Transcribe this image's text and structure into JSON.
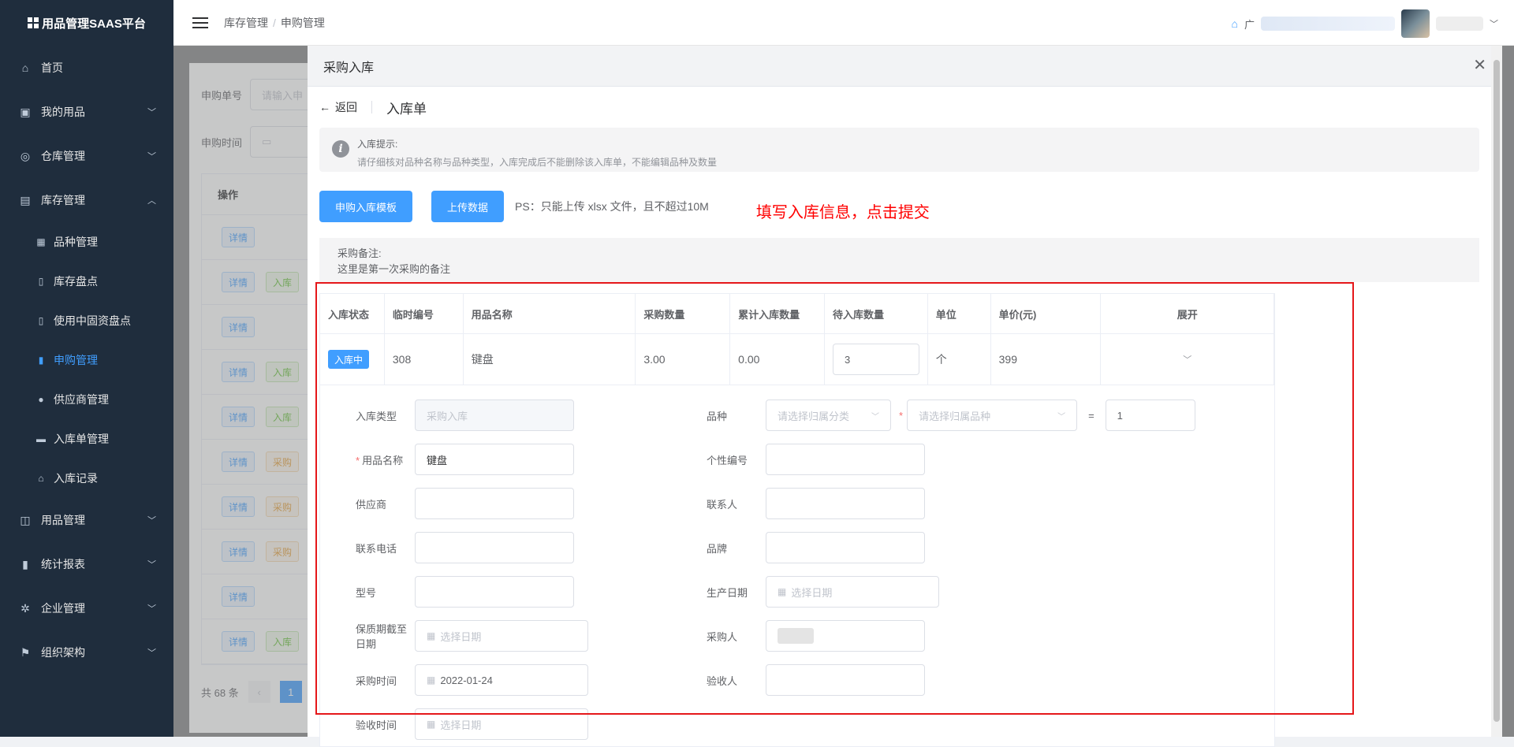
{
  "app": {
    "title": "用品管理SAAS平台"
  },
  "sidebar": {
    "items": [
      {
        "label": "首页",
        "icon": "home-icon"
      },
      {
        "label": "我的用品",
        "icon": "bag-icon"
      },
      {
        "label": "仓库管理",
        "icon": "database-icon"
      },
      {
        "label": "库存管理",
        "icon": "box-icon"
      },
      {
        "label": "用品管理",
        "icon": "inbox-icon"
      },
      {
        "label": "统计报表",
        "icon": "bar-chart-icon"
      },
      {
        "label": "企业管理",
        "icon": "gear-icon"
      },
      {
        "label": "组织架构",
        "icon": "flag-icon"
      }
    ],
    "sub": [
      {
        "label": "品种管理",
        "icon": "grid-icon"
      },
      {
        "label": "库存盘点",
        "icon": "document-icon"
      },
      {
        "label": "使用中固资盘点",
        "icon": "document-icon"
      },
      {
        "label": "申购管理",
        "icon": "bar-chart-icon"
      },
      {
        "label": "供应商管理",
        "icon": "user-icon"
      },
      {
        "label": "入库单管理",
        "icon": "monitor-icon"
      },
      {
        "label": "入库记录",
        "icon": "home-icon"
      }
    ]
  },
  "header": {
    "breadcrumb_1": "库存管理",
    "breadcrumb_sep": "/",
    "breadcrumb_2": "申购管理",
    "user_text": "广"
  },
  "background": {
    "label_order": "申购单号",
    "order_placeholder": "请输入申",
    "label_time": "申购时间",
    "col_action": "操作",
    "detail": "详情",
    "tag_in": "入库",
    "tag_buy": "采购",
    "total": "共 68 条",
    "page": "1"
  },
  "drawer": {
    "title": "采购入库",
    "back": "返回",
    "page_title": "入库单",
    "alert_title": "入库提示:",
    "alert_text": "请仔细核对品种名称与品种类型，入库完成后不能删除该入库单，不能编辑品种及数量",
    "btn_template": "申购入库模板",
    "btn_upload": "上传数据",
    "ps": "PS：只能上传 xlsx 文件，且不超过10M",
    "annotation": "填写入库信息，点击提交",
    "remark_label": "采购备注:",
    "remark_text": "这里是第一次采购的备注"
  },
  "table": {
    "headers": [
      "入库状态",
      "临时编号",
      "用品名称",
      "采购数量",
      "累计入库数量",
      "待入库数量",
      "单位",
      "单价(元)",
      "展开"
    ],
    "row": {
      "status": "入库中",
      "temp_no": "308",
      "name": "键盘",
      "qty": "3.00",
      "accum": "0.00",
      "pending": "3",
      "unit": "个",
      "price": "399"
    }
  },
  "form": {
    "type_label": "入库类型",
    "type_value": "采购入库",
    "variety_label": "品种",
    "category_placeholder": "请选择归属分类",
    "variety_placeholder": "请选择归属品种",
    "equals": "=",
    "ratio": "1",
    "name_label": "用品名称",
    "name_value": "键盘",
    "serial_label": "个性编号",
    "supplier_label": "供应商",
    "contact_label": "联系人",
    "phone_label": "联系电话",
    "brand_label": "品牌",
    "model_label": "型号",
    "prod_date_label": "生产日期",
    "date_placeholder": "选择日期",
    "expiry_label": "保质期截至日期",
    "buyer_label": "采购人",
    "buy_time_label": "采购时间",
    "buy_time_value": "2022-01-24",
    "checker_label": "验收人",
    "check_time_label": "验收时间"
  },
  "colors": {
    "primary": "#409eff",
    "sidebar": "#1f2d3d",
    "annotation": "#ff0000"
  }
}
